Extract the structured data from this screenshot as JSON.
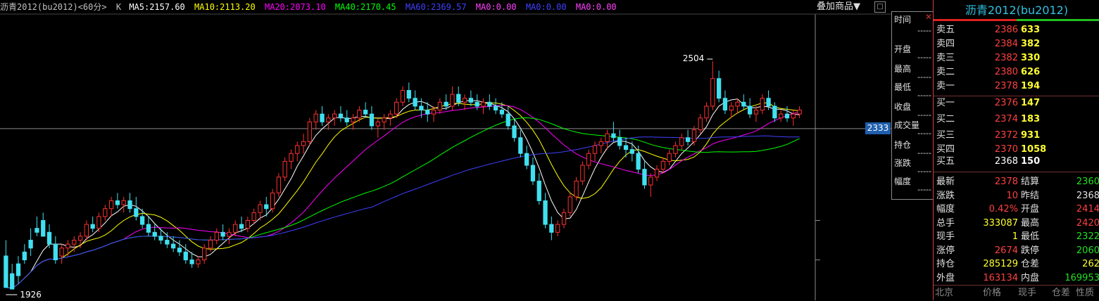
{
  "header": {
    "symbol": "沥青2012(bu2012)<60分>",
    "kind": "K",
    "ma_items": [
      {
        "text": "MA5:2157.60",
        "color": "#ffffff"
      },
      {
        "text": "MA10:2113.20",
        "color": "#ffff00"
      },
      {
        "text": "MA20:2073.10",
        "color": "#ff00ff"
      },
      {
        "text": "MA40:2170.45",
        "color": "#00ff00"
      },
      {
        "text": "MA60:2369.57",
        "color": "#4040ff"
      },
      {
        "text": "MA0:0.00",
        "color": "#ff40ff"
      },
      {
        "text": "MA0:0.00",
        "color": "#4040ff"
      },
      {
        "text": "MA0:0.00",
        "color": "#ff40ff"
      }
    ],
    "overlay_button": "叠加商品▼",
    "minimize": "□"
  },
  "chart_data": {
    "type": "candlestick",
    "ylim": [
      1910,
      2620
    ],
    "y_ticks": [
      2000,
      2100
    ],
    "crosshair_price": 2333,
    "crosshair_label": "2333",
    "annotations": [
      {
        "text": "2504",
        "value": 2504,
        "kind": "high"
      },
      {
        "text": "1926",
        "value": 1926,
        "kind": "low"
      }
    ],
    "candles": [
      [
        2010,
        2050,
        1960,
        1930
      ],
      [
        1965,
        1990,
        1930,
        1926
      ],
      [
        1990,
        2010,
        1940,
        1960
      ],
      [
        2020,
        2040,
        1990,
        2000
      ],
      [
        2050,
        2080,
        2010,
        2030
      ],
      [
        2080,
        2110,
        2060,
        2070
      ],
      [
        2100,
        2120,
        2060,
        2060
      ],
      [
        2070,
        2090,
        2030,
        2040
      ],
      [
        2040,
        2060,
        1990,
        2000
      ],
      [
        2010,
        2040,
        1990,
        2030
      ],
      [
        2030,
        2050,
        2010,
        2040
      ],
      [
        2040,
        2060,
        2020,
        2050
      ],
      [
        2050,
        2070,
        2030,
        2060
      ],
      [
        2060,
        2100,
        2050,
        2090
      ],
      [
        2090,
        2110,
        2070,
        2080
      ],
      [
        2080,
        2120,
        2070,
        2110
      ],
      [
        2110,
        2140,
        2100,
        2130
      ],
      [
        2130,
        2160,
        2110,
        2150
      ],
      [
        2150,
        2170,
        2130,
        2140
      ],
      [
        2140,
        2160,
        2120,
        2150
      ],
      [
        2150,
        2170,
        2120,
        2130
      ],
      [
        2130,
        2160,
        2100,
        2110
      ],
      [
        2110,
        2130,
        2080,
        2090
      ],
      [
        2090,
        2110,
        2060,
        2070
      ],
      [
        2070,
        2090,
        2050,
        2060
      ],
      [
        2060,
        2080,
        2040,
        2050
      ],
      [
        2050,
        2070,
        2030,
        2040
      ],
      [
        2040,
        2060,
        2020,
        2030
      ],
      [
        2030,
        2050,
        2010,
        2020
      ],
      [
        2020,
        2040,
        1990,
        2000
      ],
      [
        2000,
        2020,
        1980,
        1990
      ],
      [
        1990,
        2010,
        1980,
        2000
      ],
      [
        2000,
        2040,
        1990,
        2030
      ],
      [
        2030,
        2060,
        2020,
        2050
      ],
      [
        2050,
        2080,
        2040,
        2070
      ],
      [
        2070,
        2090,
        2050,
        2060
      ],
      [
        2060,
        2080,
        2040,
        2070
      ],
      [
        2070,
        2100,
        2060,
        2090
      ],
      [
        2090,
        2110,
        2070,
        2080
      ],
      [
        2080,
        2110,
        2070,
        2100
      ],
      [
        2100,
        2130,
        2090,
        2120
      ],
      [
        2120,
        2150,
        2100,
        2140
      ],
      [
        2140,
        2160,
        2110,
        2130
      ],
      [
        2130,
        2180,
        2120,
        2170
      ],
      [
        2170,
        2220,
        2160,
        2210
      ],
      [
        2210,
        2260,
        2200,
        2250
      ],
      [
        2250,
        2280,
        2230,
        2270
      ],
      [
        2270,
        2300,
        2250,
        2290
      ],
      [
        2290,
        2320,
        2270,
        2300
      ],
      [
        2300,
        2360,
        2290,
        2350
      ],
      [
        2350,
        2380,
        2330,
        2370
      ],
      [
        2370,
        2390,
        2340,
        2350
      ],
      [
        2350,
        2370,
        2330,
        2360
      ],
      [
        2360,
        2380,
        2340,
        2370
      ],
      [
        2370,
        2390,
        2350,
        2360
      ],
      [
        2360,
        2380,
        2340,
        2350
      ],
      [
        2350,
        2370,
        2330,
        2360
      ],
      [
        2360,
        2390,
        2350,
        2380
      ],
      [
        2380,
        2400,
        2360,
        2370
      ],
      [
        2370,
        2390,
        2330,
        2340
      ],
      [
        2340,
        2360,
        2310,
        2350
      ],
      [
        2350,
        2370,
        2330,
        2360
      ],
      [
        2360,
        2380,
        2340,
        2370
      ],
      [
        2370,
        2410,
        2360,
        2400
      ],
      [
        2400,
        2440,
        2390,
        2430
      ],
      [
        2430,
        2450,
        2400,
        2410
      ],
      [
        2410,
        2430,
        2380,
        2390
      ],
      [
        2390,
        2410,
        2360,
        2380
      ],
      [
        2380,
        2400,
        2350,
        2370
      ],
      [
        2370,
        2390,
        2350,
        2380
      ],
      [
        2380,
        2410,
        2370,
        2400
      ],
      [
        2400,
        2420,
        2380,
        2390
      ],
      [
        2390,
        2440,
        2380,
        2420
      ],
      [
        2420,
        2440,
        2390,
        2400
      ],
      [
        2400,
        2420,
        2380,
        2410
      ],
      [
        2410,
        2430,
        2390,
        2400
      ],
      [
        2400,
        2420,
        2380,
        2390
      ],
      [
        2390,
        2410,
        2370,
        2400
      ],
      [
        2400,
        2420,
        2380,
        2390
      ],
      [
        2390,
        2410,
        2370,
        2380
      ],
      [
        2380,
        2400,
        2360,
        2370
      ],
      [
        2370,
        2390,
        2330,
        2340
      ],
      [
        2340,
        2360,
        2300,
        2310
      ],
      [
        2310,
        2330,
        2260,
        2270
      ],
      [
        2270,
        2290,
        2230,
        2240
      ],
      [
        2240,
        2260,
        2190,
        2200
      ],
      [
        2200,
        2220,
        2140,
        2150
      ],
      [
        2150,
        2170,
        2080,
        2090
      ],
      [
        2090,
        2110,
        2050,
        2070
      ],
      [
        2070,
        2100,
        2060,
        2090
      ],
      [
        2090,
        2130,
        2080,
        2120
      ],
      [
        2120,
        2170,
        2110,
        2160
      ],
      [
        2160,
        2210,
        2150,
        2200
      ],
      [
        2200,
        2250,
        2190,
        2240
      ],
      [
        2240,
        2280,
        2230,
        2270
      ],
      [
        2270,
        2300,
        2250,
        2290
      ],
      [
        2290,
        2310,
        2270,
        2300
      ],
      [
        2300,
        2330,
        2280,
        2320
      ],
      [
        2320,
        2350,
        2300,
        2310
      ],
      [
        2310,
        2330,
        2280,
        2290
      ],
      [
        2290,
        2310,
        2260,
        2280
      ],
      [
        2280,
        2300,
        2250,
        2270
      ],
      [
        2270,
        2290,
        2220,
        2230
      ],
      [
        2230,
        2250,
        2180,
        2190
      ],
      [
        2190,
        2220,
        2160,
        2210
      ],
      [
        2210,
        2240,
        2200,
        2230
      ],
      [
        2230,
        2260,
        2220,
        2250
      ],
      [
        2250,
        2280,
        2240,
        2270
      ],
      [
        2270,
        2300,
        2260,
        2290
      ],
      [
        2290,
        2320,
        2280,
        2310
      ],
      [
        2310,
        2330,
        2290,
        2300
      ],
      [
        2300,
        2340,
        2290,
        2330
      ],
      [
        2330,
        2370,
        2320,
        2360
      ],
      [
        2360,
        2400,
        2350,
        2390
      ],
      [
        2390,
        2504,
        2380,
        2460
      ],
      [
        2460,
        2480,
        2400,
        2410
      ],
      [
        2410,
        2430,
        2370,
        2380
      ],
      [
        2380,
        2400,
        2360,
        2390
      ],
      [
        2390,
        2410,
        2370,
        2400
      ],
      [
        2400,
        2420,
        2380,
        2390
      ],
      [
        2390,
        2410,
        2360,
        2370
      ],
      [
        2370,
        2390,
        2350,
        2380
      ],
      [
        2380,
        2420,
        2370,
        2410
      ],
      [
        2410,
        2430,
        2380,
        2390
      ],
      [
        2390,
        2400,
        2350,
        2360
      ],
      [
        2360,
        2380,
        2350,
        2370
      ],
      [
        2370,
        2390,
        2350,
        2360
      ],
      [
        2360,
        2380,
        2340,
        2370
      ],
      [
        2370,
        2390,
        2360,
        2380
      ]
    ]
  },
  "crosshair_box": {
    "close": "✕",
    "rows": [
      "时间",
      "开盘",
      "最高",
      "最低",
      "收盘",
      "成交量",
      "持仓",
      "涨跌",
      "幅度"
    ],
    "dash": "-----"
  },
  "quote": {
    "title": "沥青2012(bu2012)",
    "asks": [
      {
        "label": "卖五",
        "price": "2386",
        "vol": "633"
      },
      {
        "label": "卖四",
        "price": "2384",
        "vol": "382"
      },
      {
        "label": "卖三",
        "price": "2382",
        "vol": "330"
      },
      {
        "label": "卖二",
        "price": "2380",
        "vol": "626"
      },
      {
        "label": "卖一",
        "price": "2378",
        "vol": "194"
      }
    ],
    "bids": [
      {
        "label": "买一",
        "price": "2376",
        "vol": "147",
        "price_color": "#ff4040",
        "vol_color": "#ffff30"
      },
      {
        "label": "买二",
        "price": "2374",
        "vol": "183",
        "price_color": "#ff4040",
        "vol_color": "#ffff30"
      },
      {
        "label": "买三",
        "price": "2372",
        "vol": "931",
        "price_color": "#ff4040",
        "vol_color": "#ffff30"
      },
      {
        "label": "买四",
        "price": "2370",
        "vol": "1058",
        "price_color": "#ff4040",
        "vol_color": "#ffff30"
      },
      {
        "label": "买五",
        "price": "2368",
        "vol": "150",
        "price_color": "#ffffff",
        "vol_color": "#ffffff"
      }
    ],
    "stats": [
      {
        "l1": "最新",
        "v1": "2378",
        "c1": "#ff4040",
        "l2": "结算",
        "v2": "2360",
        "c2": "#20e020"
      },
      {
        "l1": "涨跌",
        "v1": "10",
        "c1": "#ff4040",
        "l2": "昨结",
        "v2": "2368",
        "c2": "#e0e0e0"
      },
      {
        "l1": "幅度",
        "v1": "0.42%",
        "c1": "#ff4040",
        "l2": "开盘",
        "v2": "2414",
        "c2": "#ff4040"
      },
      {
        "l1": "总手",
        "v1": "333087",
        "c1": "#ffff30",
        "l2": "最高",
        "v2": "2420",
        "c2": "#ff4040"
      },
      {
        "l1": "现手",
        "v1": "1",
        "c1": "#ffff30",
        "l2": "最低",
        "v2": "2322",
        "c2": "#20e020"
      },
      {
        "l1": "涨停",
        "v1": "2674",
        "c1": "#ff4040",
        "l2": "跌停",
        "v2": "2060",
        "c2": "#20e020"
      },
      {
        "l1": "持仓",
        "v1": "285129",
        "c1": "#ffff30",
        "l2": "仓差",
        "v2": "262",
        "c2": "#ffff30"
      },
      {
        "l1": "外盘",
        "v1": "163134",
        "c1": "#ff4040",
        "l2": "内盘",
        "v2": "169953",
        "c2": "#20e020"
      }
    ],
    "footer": [
      "北京",
      "价格",
      "现手",
      "仓差",
      "性质"
    ]
  }
}
